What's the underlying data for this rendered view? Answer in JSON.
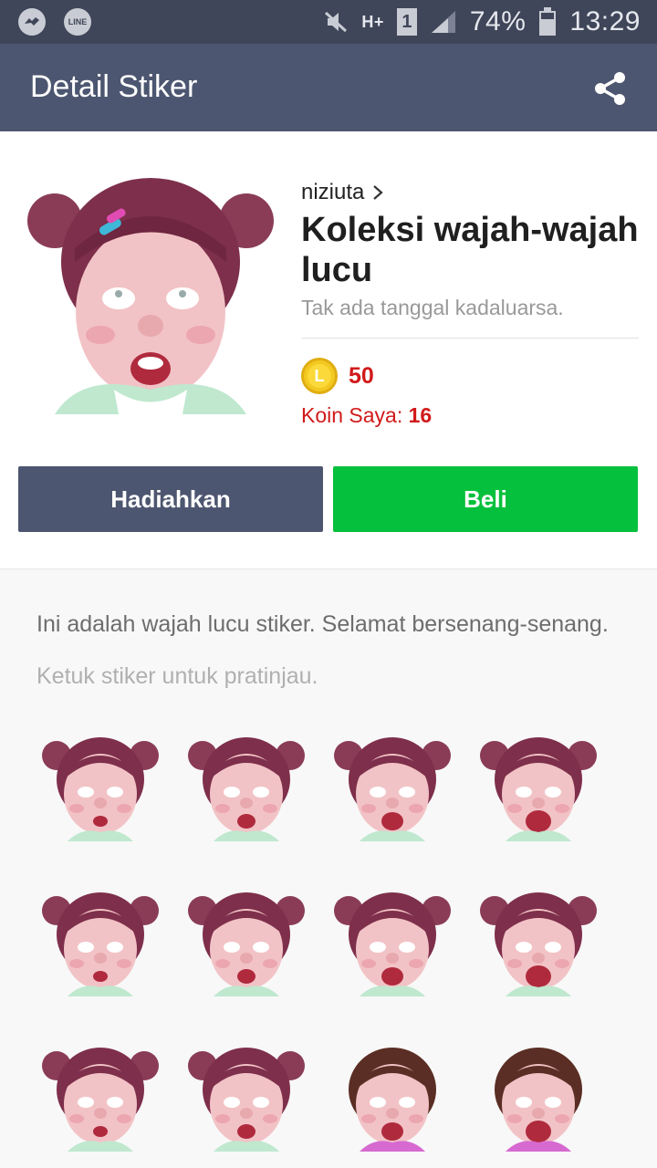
{
  "status_bar": {
    "icons": [
      "messenger-icon",
      "line-icon",
      "mute-icon",
      "hplus-icon",
      "sim1-icon",
      "signal-icon",
      "battery-icon"
    ],
    "network": "H+",
    "sim": "1",
    "battery": "74%",
    "time": "13:29"
  },
  "app_bar": {
    "title": "Detail Stiker",
    "share_icon": "share-icon"
  },
  "sticker": {
    "author": "niziuta",
    "title": "Koleksi wajah-wajah lucu",
    "expiry": "Tak ada tanggal kadaluarsa.",
    "price": "50",
    "my_coins_label": "Koin Saya:",
    "my_coins_value": "16",
    "coin_letter": "L"
  },
  "actions": {
    "gift_label": "Hadiahkan",
    "buy_label": "Beli"
  },
  "description": "Ini adalah wajah lucu stiker. Selamat bersenang-senang.",
  "preview_hint": "Ketuk stiker untuk pratinjau.",
  "colors": {
    "status_bar": "#3f4659",
    "app_bar": "#4d5670",
    "buy": "#05c03c",
    "price_red": "#d11a1a"
  }
}
